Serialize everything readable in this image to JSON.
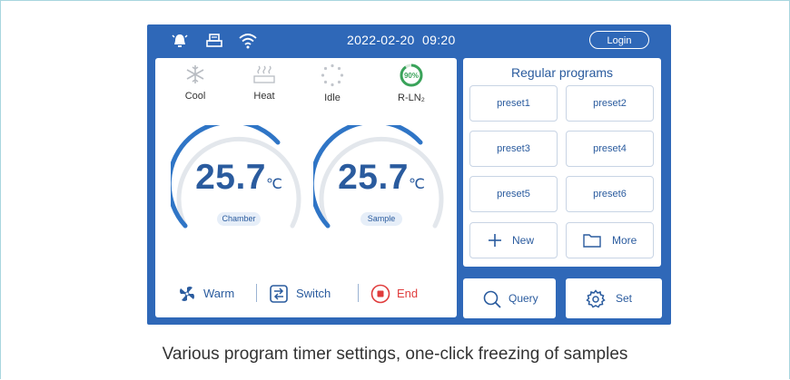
{
  "status_bar": {
    "icons": [
      "alarm-icon",
      "printer-icon",
      "wifi-icon"
    ],
    "date": "2022-02-20",
    "time": "09:20",
    "login_label": "Login"
  },
  "modes": [
    {
      "icon": "snowflake-icon",
      "label": "Cool"
    },
    {
      "icon": "heater-icon",
      "label": "Heat"
    },
    {
      "icon": "idle-spinner-icon",
      "label": "Idle"
    },
    {
      "icon": "ln2-level-icon",
      "label": "R-LN₂",
      "level_text": "90%",
      "level_fraction": 0.9
    }
  ],
  "gauges": [
    {
      "value": "25.7",
      "unit": "℃",
      "tag": "Chamber"
    },
    {
      "value": "25.7",
      "unit": "℃",
      "tag": "Sample"
    }
  ],
  "actions": [
    {
      "icon": "fan-icon",
      "label": "Warm"
    },
    {
      "icon": "switch-icon",
      "label": "Switch"
    },
    {
      "icon": "stop-icon",
      "label": "End"
    }
  ],
  "programs": {
    "title": "Regular programs",
    "presets": [
      "preset1",
      "preset2",
      "preset3",
      "preset4",
      "preset5",
      "preset6"
    ],
    "new_label": "New",
    "more_label": "More"
  },
  "bottom_buttons": {
    "query_label": "Query",
    "set_label": "Set"
  },
  "caption": "Various program timer settings, one-click freezing of samples",
  "colors": {
    "screen_bg": "#2f68b8",
    "accent_blue": "#2a5b9e",
    "gauge_arc": "#2f75c6",
    "ln2_green": "#3aa35a",
    "end_red": "#e03c3c"
  }
}
